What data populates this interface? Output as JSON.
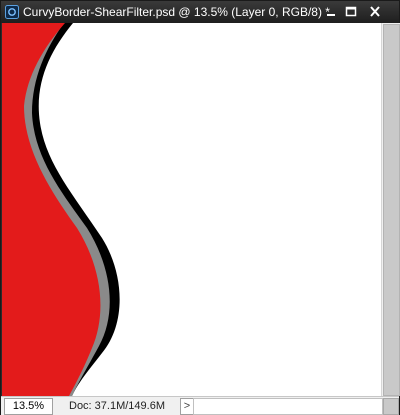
{
  "window": {
    "title": "CurvyBorder-ShearFilter.psd @ 13.5% (Layer 0, RGB/8) *",
    "app_icon": "photoshop-icon",
    "controls": {
      "minimize": "minimize-icon",
      "maximize": "maximize-icon",
      "close": "close-icon"
    }
  },
  "canvas": {
    "colors": {
      "red": "#e31b1b",
      "gray": "#8a8a8a",
      "black": "#000000",
      "background": "#ffffff"
    }
  },
  "status_bar": {
    "zoom": "13.5%",
    "doc_info": "Doc: 37.1M/149.6M",
    "arrow": ">"
  }
}
